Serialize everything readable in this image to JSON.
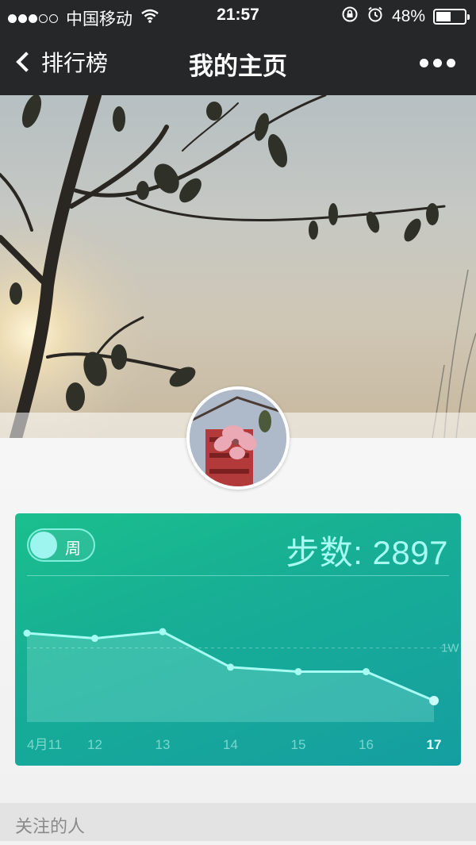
{
  "status": {
    "carrier": "中国移动",
    "time": "21:57",
    "battery_text": "48%",
    "battery_level": 0.48,
    "signal_icon": "signal-dots-icon",
    "wifi_icon": "wifi-icon",
    "lock_icon": "rotation-lock-icon",
    "alarm_icon": "alarm-icon"
  },
  "nav": {
    "back_label": "排行榜",
    "title": "我的主页",
    "more_icon": "more-dots-icon"
  },
  "card": {
    "toggle_label": "周",
    "steps_label": "步数: 2897",
    "colors": {
      "start": "#1bbf8d",
      "end": "#159ea1",
      "accent": "#a6fbf3"
    }
  },
  "chart_data": {
    "type": "area",
    "categories": [
      "4月11",
      "12",
      "13",
      "14",
      "15",
      "16",
      "17"
    ],
    "values": [
      12000,
      11300,
      12200,
      7400,
      6800,
      6800,
      2897
    ],
    "reference_line": {
      "value": 10000,
      "label": "1W"
    },
    "ylim": [
      0,
      18000
    ],
    "highlight_category": "17"
  },
  "section": {
    "title": "关注的人"
  }
}
